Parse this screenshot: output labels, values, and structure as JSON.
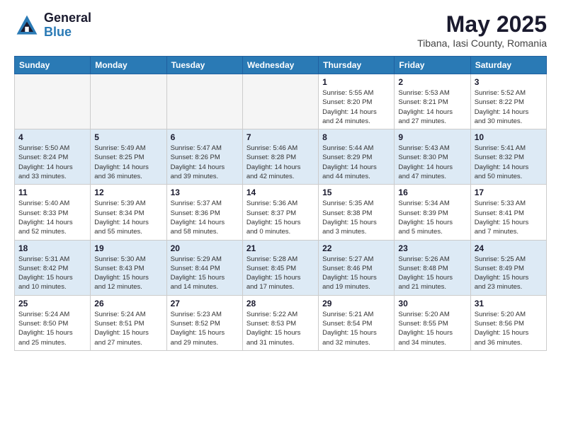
{
  "header": {
    "logo_general": "General",
    "logo_blue": "Blue",
    "month_year": "May 2025",
    "location": "Tibana, Iasi County, Romania"
  },
  "days_of_week": [
    "Sunday",
    "Monday",
    "Tuesday",
    "Wednesday",
    "Thursday",
    "Friday",
    "Saturday"
  ],
  "weeks": [
    {
      "row_class": "row-even",
      "days": [
        {
          "number": "",
          "info": "",
          "empty": true
        },
        {
          "number": "",
          "info": "",
          "empty": true
        },
        {
          "number": "",
          "info": "",
          "empty": true
        },
        {
          "number": "",
          "info": "",
          "empty": true
        },
        {
          "number": "1",
          "info": "Sunrise: 5:55 AM\nSunset: 8:20 PM\nDaylight: 14 hours\nand 24 minutes.",
          "empty": false
        },
        {
          "number": "2",
          "info": "Sunrise: 5:53 AM\nSunset: 8:21 PM\nDaylight: 14 hours\nand 27 minutes.",
          "empty": false
        },
        {
          "number": "3",
          "info": "Sunrise: 5:52 AM\nSunset: 8:22 PM\nDaylight: 14 hours\nand 30 minutes.",
          "empty": false
        }
      ]
    },
    {
      "row_class": "row-odd",
      "days": [
        {
          "number": "4",
          "info": "Sunrise: 5:50 AM\nSunset: 8:24 PM\nDaylight: 14 hours\nand 33 minutes.",
          "empty": false
        },
        {
          "number": "5",
          "info": "Sunrise: 5:49 AM\nSunset: 8:25 PM\nDaylight: 14 hours\nand 36 minutes.",
          "empty": false
        },
        {
          "number": "6",
          "info": "Sunrise: 5:47 AM\nSunset: 8:26 PM\nDaylight: 14 hours\nand 39 minutes.",
          "empty": false
        },
        {
          "number": "7",
          "info": "Sunrise: 5:46 AM\nSunset: 8:28 PM\nDaylight: 14 hours\nand 42 minutes.",
          "empty": false
        },
        {
          "number": "8",
          "info": "Sunrise: 5:44 AM\nSunset: 8:29 PM\nDaylight: 14 hours\nand 44 minutes.",
          "empty": false
        },
        {
          "number": "9",
          "info": "Sunrise: 5:43 AM\nSunset: 8:30 PM\nDaylight: 14 hours\nand 47 minutes.",
          "empty": false
        },
        {
          "number": "10",
          "info": "Sunrise: 5:41 AM\nSunset: 8:32 PM\nDaylight: 14 hours\nand 50 minutes.",
          "empty": false
        }
      ]
    },
    {
      "row_class": "row-even",
      "days": [
        {
          "number": "11",
          "info": "Sunrise: 5:40 AM\nSunset: 8:33 PM\nDaylight: 14 hours\nand 52 minutes.",
          "empty": false
        },
        {
          "number": "12",
          "info": "Sunrise: 5:39 AM\nSunset: 8:34 PM\nDaylight: 14 hours\nand 55 minutes.",
          "empty": false
        },
        {
          "number": "13",
          "info": "Sunrise: 5:37 AM\nSunset: 8:36 PM\nDaylight: 14 hours\nand 58 minutes.",
          "empty": false
        },
        {
          "number": "14",
          "info": "Sunrise: 5:36 AM\nSunset: 8:37 PM\nDaylight: 15 hours\nand 0 minutes.",
          "empty": false
        },
        {
          "number": "15",
          "info": "Sunrise: 5:35 AM\nSunset: 8:38 PM\nDaylight: 15 hours\nand 3 minutes.",
          "empty": false
        },
        {
          "number": "16",
          "info": "Sunrise: 5:34 AM\nSunset: 8:39 PM\nDaylight: 15 hours\nand 5 minutes.",
          "empty": false
        },
        {
          "number": "17",
          "info": "Sunrise: 5:33 AM\nSunset: 8:41 PM\nDaylight: 15 hours\nand 7 minutes.",
          "empty": false
        }
      ]
    },
    {
      "row_class": "row-odd",
      "days": [
        {
          "number": "18",
          "info": "Sunrise: 5:31 AM\nSunset: 8:42 PM\nDaylight: 15 hours\nand 10 minutes.",
          "empty": false
        },
        {
          "number": "19",
          "info": "Sunrise: 5:30 AM\nSunset: 8:43 PM\nDaylight: 15 hours\nand 12 minutes.",
          "empty": false
        },
        {
          "number": "20",
          "info": "Sunrise: 5:29 AM\nSunset: 8:44 PM\nDaylight: 15 hours\nand 14 minutes.",
          "empty": false
        },
        {
          "number": "21",
          "info": "Sunrise: 5:28 AM\nSunset: 8:45 PM\nDaylight: 15 hours\nand 17 minutes.",
          "empty": false
        },
        {
          "number": "22",
          "info": "Sunrise: 5:27 AM\nSunset: 8:46 PM\nDaylight: 15 hours\nand 19 minutes.",
          "empty": false
        },
        {
          "number": "23",
          "info": "Sunrise: 5:26 AM\nSunset: 8:48 PM\nDaylight: 15 hours\nand 21 minutes.",
          "empty": false
        },
        {
          "number": "24",
          "info": "Sunrise: 5:25 AM\nSunset: 8:49 PM\nDaylight: 15 hours\nand 23 minutes.",
          "empty": false
        }
      ]
    },
    {
      "row_class": "row-even",
      "days": [
        {
          "number": "25",
          "info": "Sunrise: 5:24 AM\nSunset: 8:50 PM\nDaylight: 15 hours\nand 25 minutes.",
          "empty": false
        },
        {
          "number": "26",
          "info": "Sunrise: 5:24 AM\nSunset: 8:51 PM\nDaylight: 15 hours\nand 27 minutes.",
          "empty": false
        },
        {
          "number": "27",
          "info": "Sunrise: 5:23 AM\nSunset: 8:52 PM\nDaylight: 15 hours\nand 29 minutes.",
          "empty": false
        },
        {
          "number": "28",
          "info": "Sunrise: 5:22 AM\nSunset: 8:53 PM\nDaylight: 15 hours\nand 31 minutes.",
          "empty": false
        },
        {
          "number": "29",
          "info": "Sunrise: 5:21 AM\nSunset: 8:54 PM\nDaylight: 15 hours\nand 32 minutes.",
          "empty": false
        },
        {
          "number": "30",
          "info": "Sunrise: 5:20 AM\nSunset: 8:55 PM\nDaylight: 15 hours\nand 34 minutes.",
          "empty": false
        },
        {
          "number": "31",
          "info": "Sunrise: 5:20 AM\nSunset: 8:56 PM\nDaylight: 15 hours\nand 36 minutes.",
          "empty": false
        }
      ]
    }
  ]
}
